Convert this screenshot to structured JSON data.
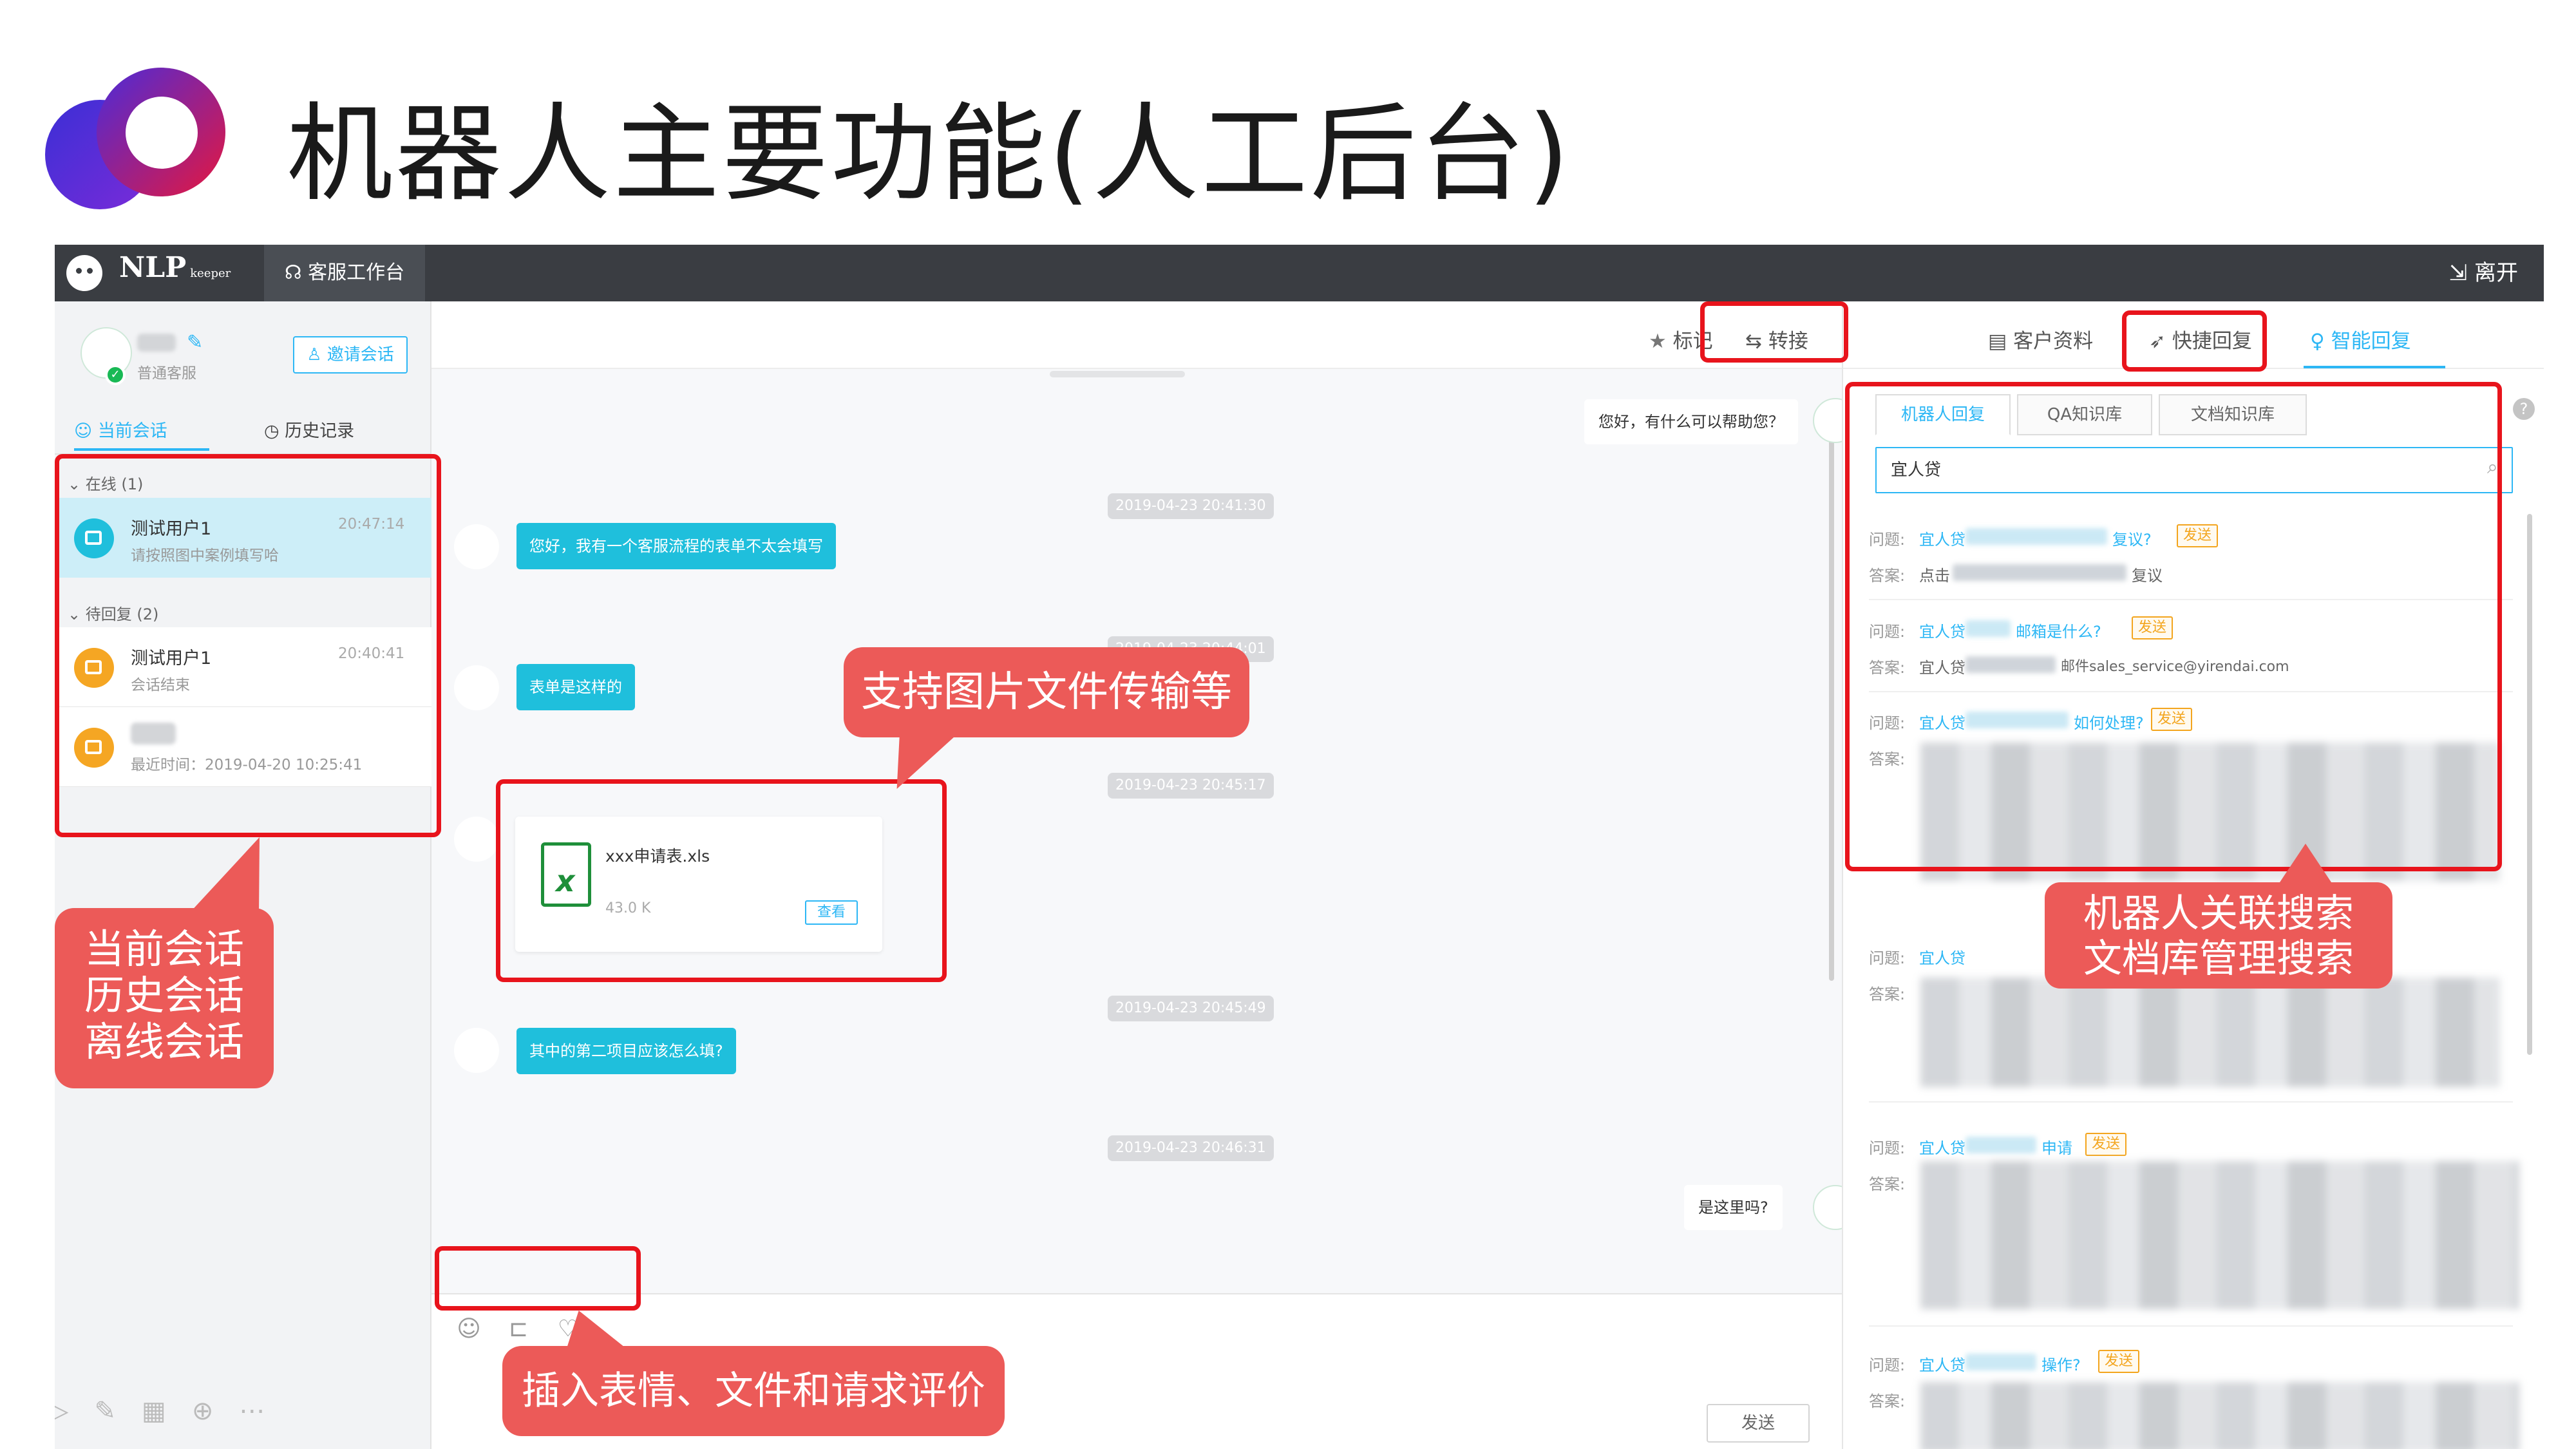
{
  "slide": {
    "title": "机器人主要功能(人工后台)"
  },
  "app": {
    "brand_name": "NLP",
    "brand_sub": "keeper",
    "workspace_tab": "客服工作台",
    "leave_label": "离开"
  },
  "agent": {
    "role": "普通客服",
    "invite_label": "邀请会话"
  },
  "left_tabs": {
    "current": "当前会话",
    "history": "历史记录"
  },
  "groups": {
    "online": "在线 (1)",
    "pending": "待回复 (2)"
  },
  "conversations": [
    {
      "name": "测试用户1",
      "sub": "请按照图中案例填写哈",
      "time": "20:47:14",
      "color": "#1fbfdc"
    },
    {
      "name": "测试用户1",
      "sub": "会话结束",
      "time": "20:40:41",
      "color": "#f5a623"
    },
    {
      "name": "",
      "sub": "最近时间：2019-04-20 10:25:41",
      "time": "",
      "color": "#f5a623"
    }
  ],
  "chat_toolbar": {
    "mark": "标记",
    "transfer": "转接"
  },
  "messages": {
    "greeting": "您好，有什么可以帮助您？",
    "ts1": "2019-04-23 20:41:30",
    "user_msg1": "您好，我有一个客服流程的表单不太会填写",
    "ts2": "2019-04-23 20:44:01",
    "user_msg2": "表单是这样的",
    "ts3": "2019-04-23 20:45:17",
    "file_name": "xxx申请表.xls",
    "file_size": "43.0 K",
    "file_view": "查看",
    "ts4": "2019-04-23 20:45:49",
    "user_msg3": "其中的第二项目应该怎么填?",
    "ts5": "2019-04-23 20:46:31",
    "agent_reply": "是这里吗?"
  },
  "input": {
    "send_label": "发送"
  },
  "right_tabs": {
    "customer": "客户资料",
    "quick_reply": "快捷回复",
    "smart_reply": "智能回复"
  },
  "kb_tabs": [
    "机器人回复",
    "QA知识库",
    "文档知识库"
  ],
  "search": {
    "value": "宜人贷"
  },
  "qa": {
    "q_label": "问题:",
    "a_label": "答案:",
    "send_tag": "发送",
    "items": [
      {
        "q_pre": "宜人贷",
        "q_post": "复议?",
        "a_pre": "点击",
        "a_post": "复议"
      },
      {
        "q_pre": "宜人贷",
        "q_post": "邮箱是什么?",
        "a_pre": "宜人贷",
        "a_post": "邮件sales_service@yirendai.com"
      },
      {
        "q_pre": "宜人贷",
        "q_post": "如何处理?",
        "a_pre": "",
        "a_post": ""
      },
      {
        "q_pre": "宜人贷",
        "q_post": "",
        "a_pre": "",
        "a_post": ""
      },
      {
        "q_pre": "宜人贷",
        "q_post": "申请",
        "a_pre": "",
        "a_post": ""
      },
      {
        "q_pre": "宜人贷",
        "q_post": "操作?",
        "a_pre": "",
        "a_post": ""
      }
    ]
  },
  "annotations": {
    "file_support": "支持图片文件传输等",
    "sessions": [
      "当前会话",
      "历史会话",
      "离线会话"
    ],
    "insert": "插入表情、文件和请求评价",
    "search_line1": "机器人关联搜索",
    "search_line2": "文档库管理搜索"
  },
  "colors": {
    "accent": "#2db7f5",
    "bubble": "#1fbfdc",
    "annotation_red": "#e8141c",
    "callout": "#ec5a58",
    "topbar": "#3a3d42"
  }
}
